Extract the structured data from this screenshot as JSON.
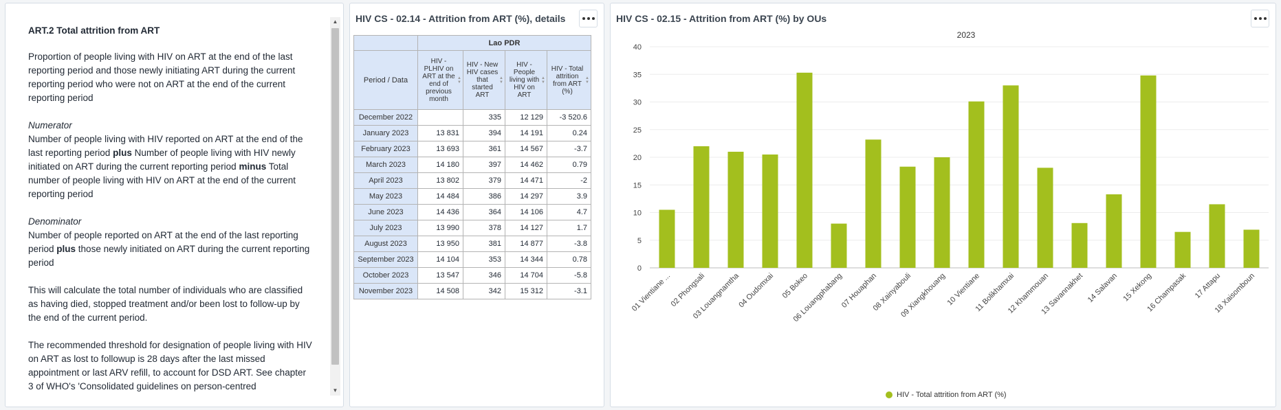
{
  "text_panel": {
    "heading": "ART.2 Total attrition from ART",
    "definition": "Proportion of people living with HIV on ART at the end of the last reporting period and those newly initiating ART during the current reporting period who were not on ART at the end of the current reporting period",
    "numerator_title": "Numerator",
    "numerator_1": "Number of people living with HIV reported on ART at the end of the last reporting period ",
    "numerator_plus": "plus",
    "numerator_2": " Number of people living with HIV newly initiated on ART during the current reporting period ",
    "numerator_minus": "minus",
    "numerator_3": " Total number of people living with HIV on ART at the end of the current reporting period",
    "denominator_title": "Denominator",
    "denominator_1": "Number of people reported on ART at the end of the last reporting period ",
    "denominator_plus": "plus",
    "denominator_2": " those newly initiated on ART during the current reporting period",
    "calc_note": "This will calculate the total number of individuals who are classified as having died, stopped treatment and/or been lost to follow-up by the end of the current period.",
    "threshold_note": "The recommended threshold for designation of people living with HIV on ART as lost to followup is 28 days after the last missed appointment or last ARV refill, to account for DSD ART. See chapter 3 of WHO's 'Consolidated guidelines on person-centred"
  },
  "table_panel": {
    "title": "HIV CS - 02.14 - Attrition from ART (%), details",
    "org_unit": "Lao PDR",
    "row_header": "Period / Data",
    "columns": [
      "HIV - PLHIV on ART at the end of previous month",
      "HIV - New HIV cases that started ART",
      "HIV - People living with HIV on ART",
      "HIV - Total attrition from ART (%)"
    ],
    "rows": [
      {
        "period": "December 2022",
        "v": [
          "",
          "335",
          "12 129",
          "-3 520.6"
        ]
      },
      {
        "period": "January 2023",
        "v": [
          "13 831",
          "394",
          "14 191",
          "0.24"
        ]
      },
      {
        "period": "February 2023",
        "v": [
          "13 693",
          "361",
          "14 567",
          "-3.7"
        ]
      },
      {
        "period": "March 2023",
        "v": [
          "14 180",
          "397",
          "14 462",
          "0.79"
        ]
      },
      {
        "period": "April 2023",
        "v": [
          "13 802",
          "379",
          "14 471",
          "-2"
        ]
      },
      {
        "period": "May 2023",
        "v": [
          "14 484",
          "386",
          "14 297",
          "3.9"
        ]
      },
      {
        "period": "June 2023",
        "v": [
          "14 436",
          "364",
          "14 106",
          "4.7"
        ]
      },
      {
        "period": "July 2023",
        "v": [
          "13 990",
          "378",
          "14 127",
          "1.7"
        ]
      },
      {
        "period": "August 2023",
        "v": [
          "13 950",
          "381",
          "14 877",
          "-3.8"
        ]
      },
      {
        "period": "September 2023",
        "v": [
          "14 104",
          "353",
          "14 344",
          "0.78"
        ]
      },
      {
        "period": "October 2023",
        "v": [
          "13 547",
          "346",
          "14 704",
          "-5.8"
        ]
      },
      {
        "period": "November 2023",
        "v": [
          "14 508",
          "342",
          "15 312",
          "-3.1"
        ]
      }
    ]
  },
  "chart_panel": {
    "title": "HIV CS - 02.15 - Attrition from ART (%) by OUs"
  },
  "chart_data": {
    "type": "bar",
    "title": "2023",
    "categories": [
      "01 Vientiane ...",
      "02 Phongsali",
      "03 Louangnamtha",
      "04 Oudomxai",
      "05 Bokeo",
      "06 Louangphabang",
      "07 Houaphan",
      "08 Xainyabouli",
      "09 Xiangkhouang",
      "10 Vientiane",
      "11 Bolikhamxai",
      "12 Khammouan",
      "13 Savannakhet",
      "14 Salavan",
      "15 Xekong",
      "16 Champasak",
      "17 Attapu",
      "18 Xaisomboun"
    ],
    "series": [
      {
        "name": "HIV - Total attrition from ART (%)",
        "values": [
          10.5,
          22,
          21,
          20.5,
          35.3,
          8,
          23.2,
          18.3,
          20,
          30.1,
          33,
          18.1,
          8.1,
          13.3,
          34.8,
          6.5,
          11.5,
          6.9
        ]
      }
    ],
    "ylim": [
      0,
      40
    ],
    "yticks": [
      0,
      5,
      10,
      15,
      20,
      25,
      30,
      35,
      40
    ],
    "grid": true,
    "legend": "bottom",
    "color": "#a3bf1e"
  }
}
